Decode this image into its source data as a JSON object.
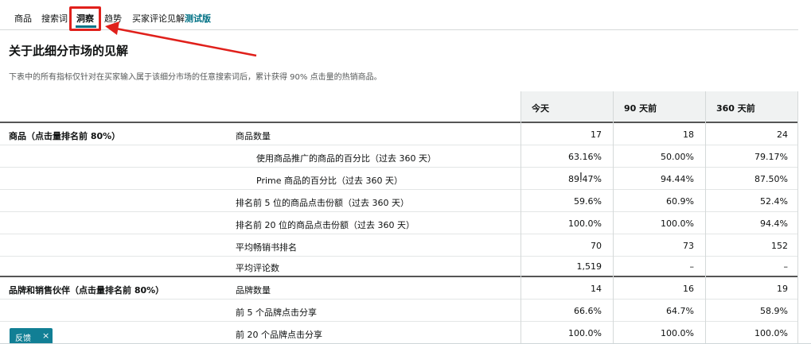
{
  "tabs": [
    {
      "label": "商品"
    },
    {
      "label": "搜索词"
    },
    {
      "label": "洞察"
    },
    {
      "label": "趋势"
    },
    {
      "label": "买家评论见解"
    }
  ],
  "beta_label": "测试版",
  "active_tab": "洞察",
  "page": {
    "title": "关于此细分市场的见解",
    "description": "下表中的所有指标仅针对在买家输入属于该细分市场的任意搜索词后，累计获得 90% 点击量的热销商品。"
  },
  "table": {
    "columns": [
      "今天",
      "90 天前",
      "360 天前"
    ],
    "rows": [
      {
        "section": "商品（点击量排名前 80%）",
        "metric": "商品数量",
        "values": [
          "17",
          "18",
          "24"
        ]
      },
      {
        "section": "",
        "metric": "使用商品推广的商品的百分比（过去 360 天）",
        "values": [
          "63.16%",
          "50.00%",
          "79.17%"
        ]
      },
      {
        "section": "",
        "metric": "Prime 商品的百分比（过去 360 天）",
        "values": [
          "89.47%",
          "94.44%",
          "87.50%"
        ]
      },
      {
        "section": "",
        "metric": "排名前 5 位的商品点击份额（过去 360 天）",
        "values": [
          "59.6%",
          "60.9%",
          "52.4%"
        ]
      },
      {
        "section": "",
        "metric": "排名前 20 位的商品点击份额（过去 360 天）",
        "values": [
          "100.0%",
          "100.0%",
          "94.4%"
        ]
      },
      {
        "section": "",
        "metric": "平均畅销书排名",
        "values": [
          "70",
          "73",
          "152"
        ]
      },
      {
        "section": "",
        "metric": "平均评论数",
        "values": [
          "1,519",
          "–",
          "–"
        ]
      },
      {
        "section": "品牌和销售伙伴（点击量排名前 80%）",
        "metric": "品牌数量",
        "values": [
          "14",
          "16",
          "19"
        ]
      },
      {
        "section": "",
        "metric": "前 5 个品牌点击分享",
        "values": [
          "66.6%",
          "64.7%",
          "58.9%"
        ]
      },
      {
        "section": "",
        "metric": "前 20 个品牌点击分享",
        "values": [
          "100.0%",
          "100.0%",
          "100.0%"
        ]
      }
    ]
  },
  "feedback": {
    "label": "反馈",
    "close": "×"
  },
  "colors": {
    "accent": "#007185",
    "annotation": "#e0201b",
    "feedback_bg": "#117f95"
  }
}
